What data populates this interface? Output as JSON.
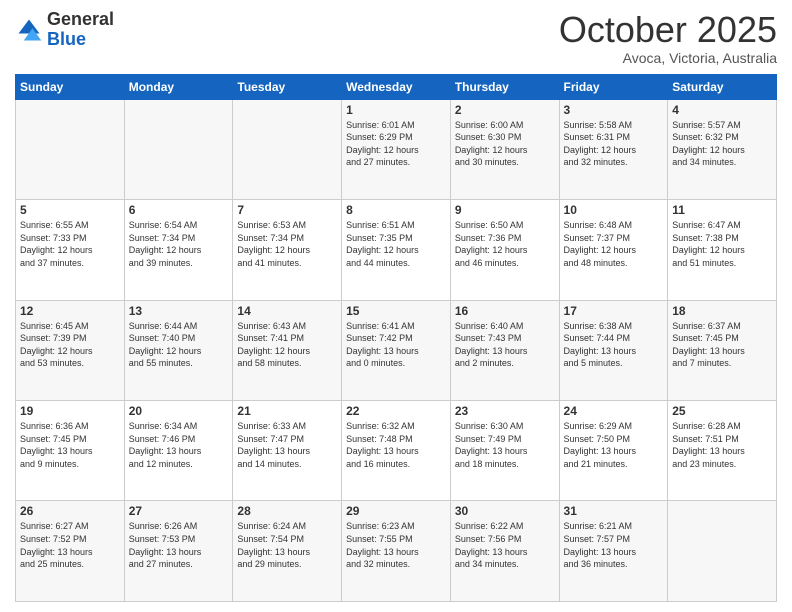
{
  "header": {
    "logo_general": "General",
    "logo_blue": "Blue",
    "month_title": "October 2025",
    "location": "Avoca, Victoria, Australia"
  },
  "days_of_week": [
    "Sunday",
    "Monday",
    "Tuesday",
    "Wednesday",
    "Thursday",
    "Friday",
    "Saturday"
  ],
  "weeks": [
    [
      {
        "day": "",
        "info": ""
      },
      {
        "day": "",
        "info": ""
      },
      {
        "day": "",
        "info": ""
      },
      {
        "day": "1",
        "info": "Sunrise: 6:01 AM\nSunset: 6:29 PM\nDaylight: 12 hours\nand 27 minutes."
      },
      {
        "day": "2",
        "info": "Sunrise: 6:00 AM\nSunset: 6:30 PM\nDaylight: 12 hours\nand 30 minutes."
      },
      {
        "day": "3",
        "info": "Sunrise: 5:58 AM\nSunset: 6:31 PM\nDaylight: 12 hours\nand 32 minutes."
      },
      {
        "day": "4",
        "info": "Sunrise: 5:57 AM\nSunset: 6:32 PM\nDaylight: 12 hours\nand 34 minutes."
      }
    ],
    [
      {
        "day": "5",
        "info": "Sunrise: 6:55 AM\nSunset: 7:33 PM\nDaylight: 12 hours\nand 37 minutes."
      },
      {
        "day": "6",
        "info": "Sunrise: 6:54 AM\nSunset: 7:34 PM\nDaylight: 12 hours\nand 39 minutes."
      },
      {
        "day": "7",
        "info": "Sunrise: 6:53 AM\nSunset: 7:34 PM\nDaylight: 12 hours\nand 41 minutes."
      },
      {
        "day": "8",
        "info": "Sunrise: 6:51 AM\nSunset: 7:35 PM\nDaylight: 12 hours\nand 44 minutes."
      },
      {
        "day": "9",
        "info": "Sunrise: 6:50 AM\nSunset: 7:36 PM\nDaylight: 12 hours\nand 46 minutes."
      },
      {
        "day": "10",
        "info": "Sunrise: 6:48 AM\nSunset: 7:37 PM\nDaylight: 12 hours\nand 48 minutes."
      },
      {
        "day": "11",
        "info": "Sunrise: 6:47 AM\nSunset: 7:38 PM\nDaylight: 12 hours\nand 51 minutes."
      }
    ],
    [
      {
        "day": "12",
        "info": "Sunrise: 6:45 AM\nSunset: 7:39 PM\nDaylight: 12 hours\nand 53 minutes."
      },
      {
        "day": "13",
        "info": "Sunrise: 6:44 AM\nSunset: 7:40 PM\nDaylight: 12 hours\nand 55 minutes."
      },
      {
        "day": "14",
        "info": "Sunrise: 6:43 AM\nSunset: 7:41 PM\nDaylight: 12 hours\nand 58 minutes."
      },
      {
        "day": "15",
        "info": "Sunrise: 6:41 AM\nSunset: 7:42 PM\nDaylight: 13 hours\nand 0 minutes."
      },
      {
        "day": "16",
        "info": "Sunrise: 6:40 AM\nSunset: 7:43 PM\nDaylight: 13 hours\nand 2 minutes."
      },
      {
        "day": "17",
        "info": "Sunrise: 6:38 AM\nSunset: 7:44 PM\nDaylight: 13 hours\nand 5 minutes."
      },
      {
        "day": "18",
        "info": "Sunrise: 6:37 AM\nSunset: 7:45 PM\nDaylight: 13 hours\nand 7 minutes."
      }
    ],
    [
      {
        "day": "19",
        "info": "Sunrise: 6:36 AM\nSunset: 7:45 PM\nDaylight: 13 hours\nand 9 minutes."
      },
      {
        "day": "20",
        "info": "Sunrise: 6:34 AM\nSunset: 7:46 PM\nDaylight: 13 hours\nand 12 minutes."
      },
      {
        "day": "21",
        "info": "Sunrise: 6:33 AM\nSunset: 7:47 PM\nDaylight: 13 hours\nand 14 minutes."
      },
      {
        "day": "22",
        "info": "Sunrise: 6:32 AM\nSunset: 7:48 PM\nDaylight: 13 hours\nand 16 minutes."
      },
      {
        "day": "23",
        "info": "Sunrise: 6:30 AM\nSunset: 7:49 PM\nDaylight: 13 hours\nand 18 minutes."
      },
      {
        "day": "24",
        "info": "Sunrise: 6:29 AM\nSunset: 7:50 PM\nDaylight: 13 hours\nand 21 minutes."
      },
      {
        "day": "25",
        "info": "Sunrise: 6:28 AM\nSunset: 7:51 PM\nDaylight: 13 hours\nand 23 minutes."
      }
    ],
    [
      {
        "day": "26",
        "info": "Sunrise: 6:27 AM\nSunset: 7:52 PM\nDaylight: 13 hours\nand 25 minutes."
      },
      {
        "day": "27",
        "info": "Sunrise: 6:26 AM\nSunset: 7:53 PM\nDaylight: 13 hours\nand 27 minutes."
      },
      {
        "day": "28",
        "info": "Sunrise: 6:24 AM\nSunset: 7:54 PM\nDaylight: 13 hours\nand 29 minutes."
      },
      {
        "day": "29",
        "info": "Sunrise: 6:23 AM\nSunset: 7:55 PM\nDaylight: 13 hours\nand 32 minutes."
      },
      {
        "day": "30",
        "info": "Sunrise: 6:22 AM\nSunset: 7:56 PM\nDaylight: 13 hours\nand 34 minutes."
      },
      {
        "day": "31",
        "info": "Sunrise: 6:21 AM\nSunset: 7:57 PM\nDaylight: 13 hours\nand 36 minutes."
      },
      {
        "day": "",
        "info": ""
      }
    ]
  ]
}
